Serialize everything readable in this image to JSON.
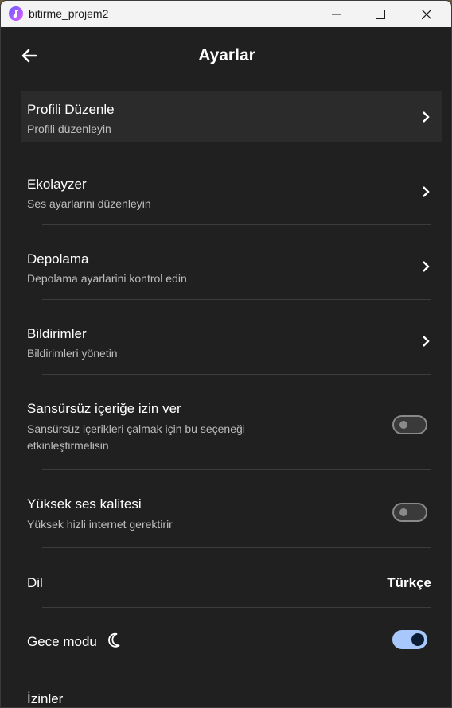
{
  "window": {
    "title": "bitirme_projem2",
    "controls": [
      "minimize-icon",
      "maximize-icon",
      "close-icon"
    ]
  },
  "appbar": {
    "title": "Ayarlar",
    "back_icon": "arrow-left-icon"
  },
  "settings": {
    "profile": {
      "title": "Profili Düzenle",
      "subtitle": "Profili düzenleyin"
    },
    "equalizer": {
      "title": "Ekolayzer",
      "subtitle": "Ses ayarlarini düzenleyin"
    },
    "storage": {
      "title": "Depolama",
      "subtitle": "Depolama ayarlarini kontrol edin"
    },
    "notifications": {
      "title": "Bildirimler",
      "subtitle": "Bildirimleri yönetin"
    },
    "explicit": {
      "title": "Sansürsüz içeriğe izin ver",
      "subtitle_line1": "Sansürsüz içerikleri çalmak için bu seçeneği",
      "subtitle_line2": "etkinleştirmelisin",
      "enabled": false
    },
    "high_quality": {
      "title": "Yüksek ses kalitesi",
      "subtitle": "Yüksek hizli internet gerektirir",
      "enabled": false
    },
    "language": {
      "title": "Dil",
      "value": "Türkçe"
    },
    "night_mode": {
      "title": "Gece modu",
      "icon": "moon-icon",
      "enabled": true
    },
    "permissions": {
      "title": "İzinler"
    }
  },
  "colors": {
    "background": "#202020",
    "highlight": "#2b2b2b",
    "accent_toggle": "#a8c7fa",
    "text": "#ffffff",
    "subtext": "#bdbdbd"
  }
}
